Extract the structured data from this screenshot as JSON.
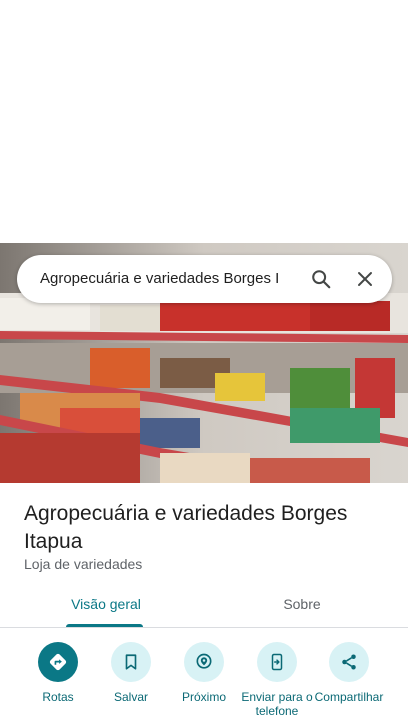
{
  "search": {
    "query": "Agropecuária e variedades Borges I"
  },
  "place": {
    "name": "Agropecuária e variedades Borges Itapua",
    "category": "Loja de variedades"
  },
  "tabs": [
    {
      "label": "Visão geral",
      "selected": true
    },
    {
      "label": "Sobre",
      "selected": false
    }
  ],
  "actions": [
    {
      "label": "Rotas",
      "icon": "directions-icon"
    },
    {
      "label": "Salvar",
      "icon": "bookmark-icon"
    },
    {
      "label": "Próximo",
      "icon": "nearby-icon"
    },
    {
      "label": "Enviar para o telefone",
      "icon": "send-to-phone-icon"
    },
    {
      "label": "Compartilhar",
      "icon": "share-icon"
    }
  ],
  "colors": {
    "accent": "#0b7886",
    "accent_light": "#d8f2f5",
    "text": "#1f1f1f",
    "secondary_text": "#5f6368"
  }
}
